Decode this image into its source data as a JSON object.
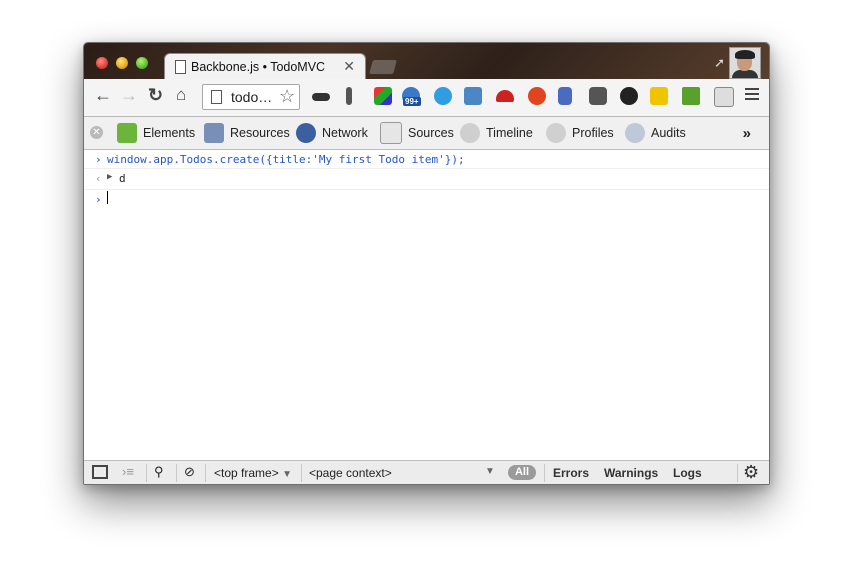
{
  "browser": {
    "tab": {
      "title": "Backbone.js • TodoMVC",
      "close": "✕"
    },
    "omnibox": {
      "url": "todo…"
    }
  },
  "devtools": {
    "tabs": [
      {
        "label": "Elements"
      },
      {
        "label": "Resources"
      },
      {
        "label": "Network"
      },
      {
        "label": "Sources"
      },
      {
        "label": "Timeline"
      },
      {
        "label": "Profiles"
      },
      {
        "label": "Audits"
      }
    ],
    "more": "»"
  },
  "console": {
    "input_line": "window.app.Todos.create({title:'My first Todo item'});",
    "result": "d"
  },
  "statusbar": {
    "frame": "<top frame>",
    "context": "<page context>",
    "filters": {
      "all": "All",
      "errors": "Errors",
      "warnings": "Warnings",
      "logs": "Logs"
    }
  }
}
